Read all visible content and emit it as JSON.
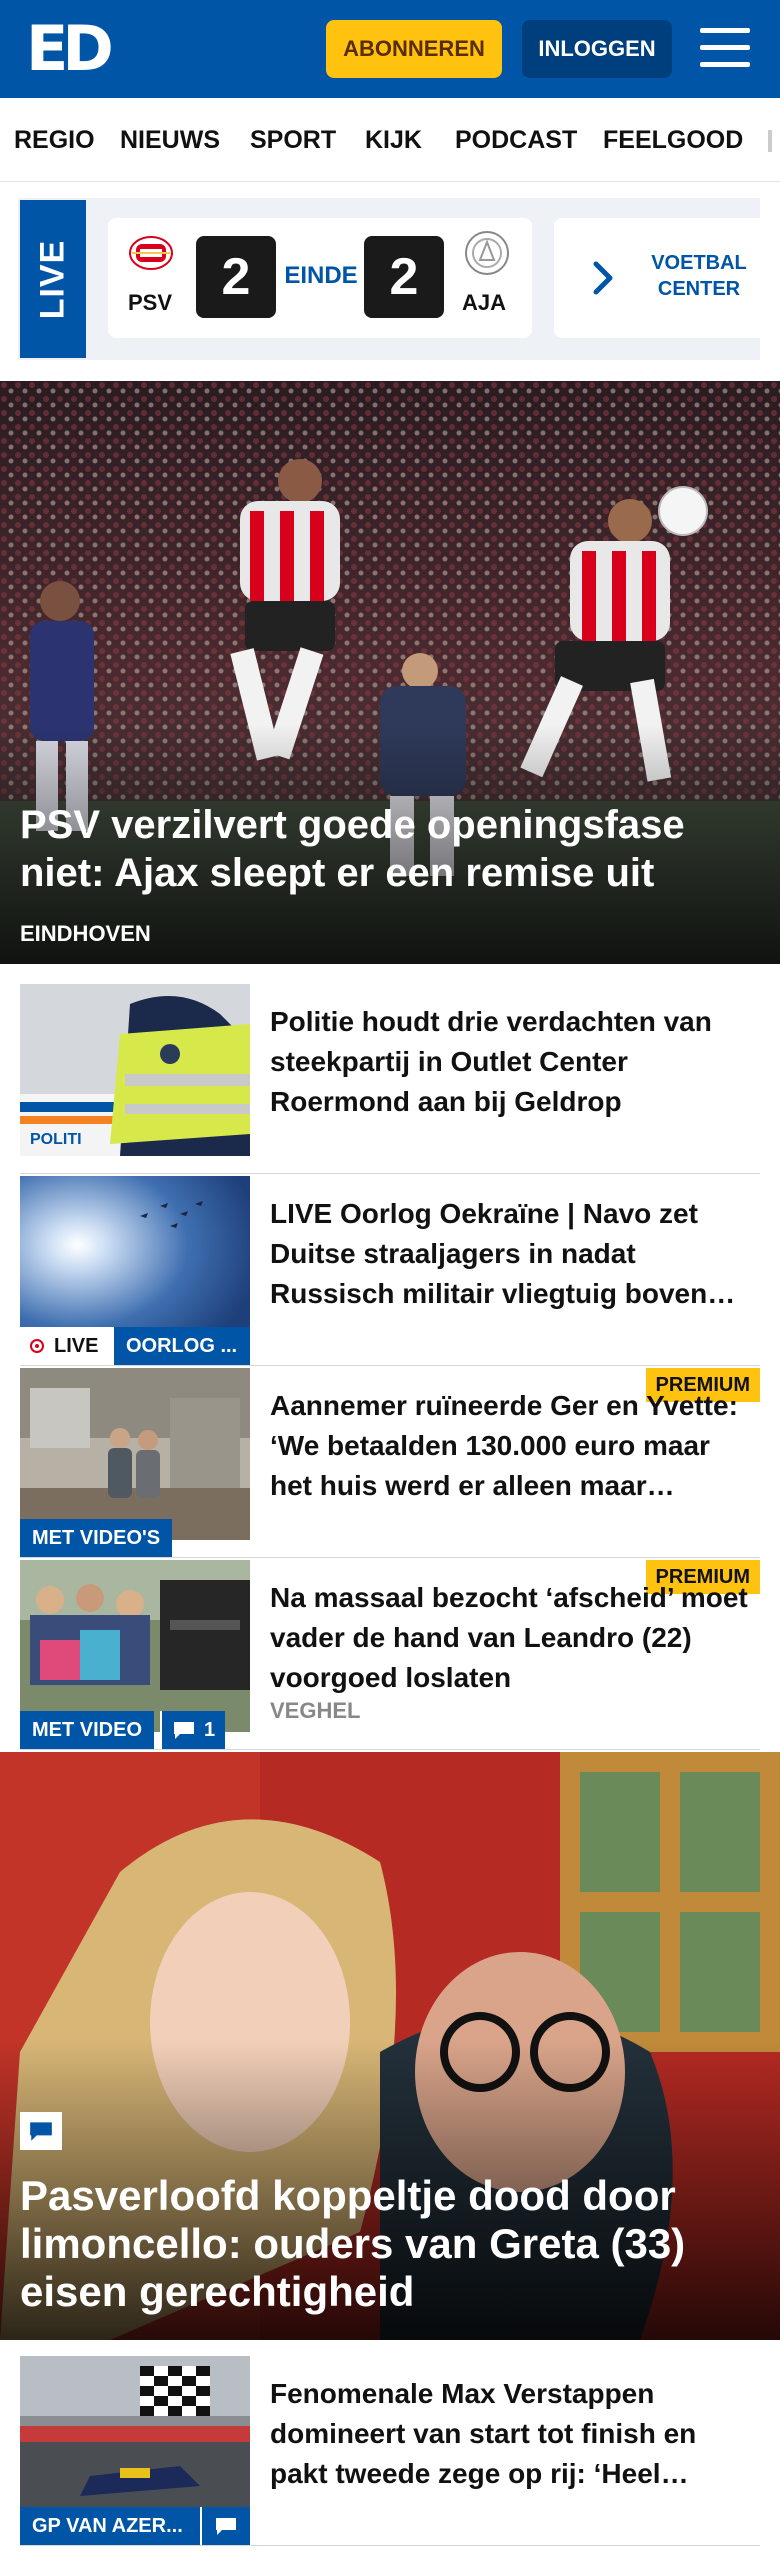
{
  "header": {
    "logo": "ED",
    "subscribe_label": "ABONNEREN",
    "login_label": "INLOGGEN"
  },
  "nav": {
    "items": [
      "REGIO",
      "NIEUWS",
      "SPORT",
      "KIJK",
      "PODCAST",
      "FEELGOOD"
    ]
  },
  "live_ticker": {
    "tag": "LIVE",
    "match": {
      "home_team": "PSV",
      "away_team": "AJA",
      "home_score": "2",
      "away_score": "2",
      "status": "EINDE"
    },
    "voetbalcenter_label": "VOETBAL CENTER"
  },
  "hero": {
    "title": "PSV verzilvert goede openingsfase niet: Ajax sleept er een remise uit",
    "location": "EINDHOVEN"
  },
  "articles": [
    {
      "title": "Politie houdt drie verdachten van steekpartij in Outlet Center Roermond aan bij Geldrop",
      "thumb_text": "POLITI"
    },
    {
      "title": "LIVE Oorlog Oekraïne | Navo zet Duitse straaljagers in nadat Russisch militair vliegtuig boven Oostzee...",
      "live_label": "LIVE",
      "tag": "OORLOG ..."
    },
    {
      "title": "Aannemer ruïneerde Ger en Yvette: ‘We betaalden 130.000 euro maar het huis werd er alleen maar slechter van’",
      "premium_label": "PREMIUM",
      "video_label": "MET VIDEO'S"
    },
    {
      "title": "Na massaal bezocht ‘afscheid’ moet vader de hand van Leandro (22) voorgoed loslaten",
      "premium_label": "PREMIUM",
      "video_label": "MET VIDEO",
      "comment_count": "1",
      "location": "VEGHEL"
    }
  ],
  "feature": {
    "title": "Pasverloofd koppeltje dood door limoncello: ouders van Greta (33) eisen gerechtigheid"
  },
  "article_bottom": {
    "title": "Fenomenale Max Verstappen domineert van start tot finish en pakt tweede zege op rij: ‘Heel happy’",
    "tag": "GP VAN AZER..."
  },
  "colors": {
    "brand_blue": "#0055a6",
    "premium_yellow": "#ffc20e",
    "live_red": "#d9001b"
  },
  "icons": {
    "menu": "hamburger-icon",
    "chevron": "chevron-right-icon",
    "comment": "comment-bubble-icon"
  }
}
